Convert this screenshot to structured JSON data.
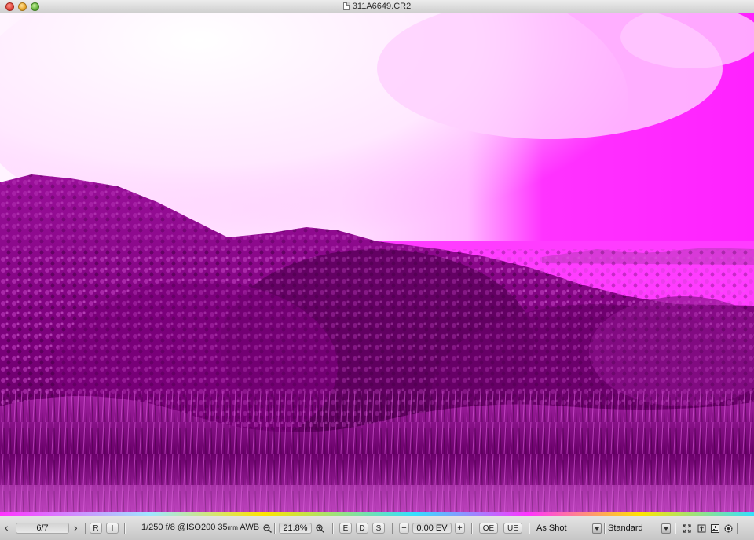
{
  "window": {
    "title": "311A6649.CR2"
  },
  "photo": {
    "description_colors": {
      "sky": "#ffe6ff",
      "cloud_edge": "#ff7cff",
      "bay": "#ff33ff",
      "hills": "#8a008a",
      "foreground": "#5e005e"
    }
  },
  "toolbar": {
    "prev_icon": "chevron-left-icon",
    "page_counter": "6/7",
    "next_icon": "chevron-right-icon",
    "r_label": "R",
    "i_label": "I",
    "exif": "1/250 f/8 @ISO200 35",
    "exif_unit": "mm",
    "exif_wb": "AWB",
    "zoom_out_icon": "zoom-out-icon",
    "zoom_value": "21.8%",
    "zoom_in_icon": "zoom-in-icon",
    "e_label": "E",
    "d_label": "D",
    "s_label": "S",
    "ev_minus": "−",
    "ev_value": "0.00 EV",
    "ev_plus": "+",
    "oe_label": "OE",
    "ue_label": "UE",
    "wb_value": "As Shot",
    "tone_value": "Standard Tone",
    "icons": [
      "fullscreen-icon",
      "export-icon",
      "adjust-icon",
      "settings-icon"
    ]
  }
}
